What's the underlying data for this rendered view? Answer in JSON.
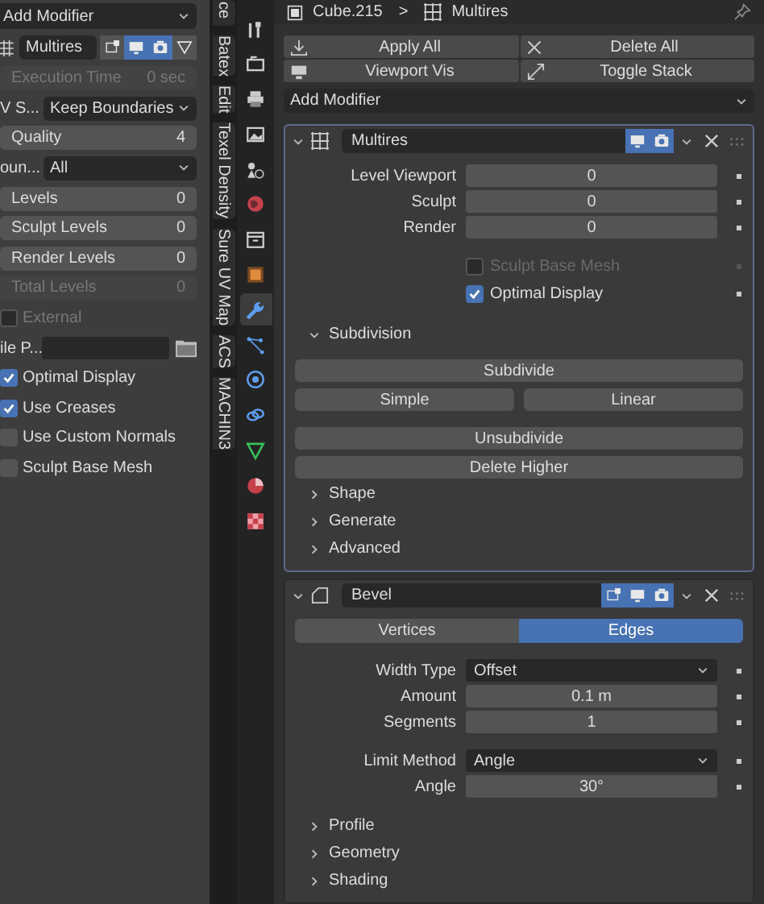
{
  "left_panel": {
    "add_modifier": "Add Modifier",
    "modifier": {
      "name": "Multires",
      "toggles": [
        {
          "kind": "editmode",
          "on": false
        },
        {
          "kind": "viewport",
          "on": true
        },
        {
          "kind": "render",
          "on": true
        },
        {
          "kind": "cage",
          "on": false
        }
      ]
    },
    "rows": [
      {
        "kind": "number",
        "label": "Execution Time",
        "value": "0 sec",
        "disabled": true
      },
      {
        "kind": "dropdown",
        "label": "V S...",
        "value": "Keep Boundaries"
      },
      {
        "kind": "number",
        "label": "Quality",
        "value": "4",
        "disabled": false
      },
      {
        "kind": "dropdown",
        "label": "oun...",
        "value": "All"
      },
      {
        "kind": "number",
        "label": "Levels",
        "value": "0",
        "disabled": false
      },
      {
        "kind": "number",
        "label": "Sculpt Levels",
        "value": "0",
        "disabled": false
      },
      {
        "kind": "number",
        "label": "Render Levels",
        "value": "0",
        "disabled": false
      },
      {
        "kind": "number",
        "label": "Total Levels",
        "value": "0",
        "disabled": true
      },
      {
        "kind": "checkbox",
        "label": "External",
        "checked": false,
        "disabled": true
      },
      {
        "kind": "path",
        "label": "ile P..."
      },
      {
        "kind": "checkbox",
        "label": "Optimal Display",
        "checked": true,
        "disabled": false
      },
      {
        "kind": "checkbox",
        "label": "Use Creases",
        "checked": true,
        "disabled": false
      },
      {
        "kind": "checkbox",
        "label": "Use Custom Normals",
        "checked": false,
        "disabled": false
      },
      {
        "kind": "checkbox",
        "label": "Sculpt Base Mesh",
        "checked": false,
        "disabled": false
      }
    ]
  },
  "sidebar_tabs": [
    {
      "label": "ce"
    },
    {
      "label": "Batex"
    },
    {
      "label": "Edit"
    },
    {
      "label": "Texel Density"
    },
    {
      "label": "Sure UV Map"
    },
    {
      "label": "ACS"
    },
    {
      "label": "MACHIN3"
    }
  ],
  "property_tabs": [
    {
      "kind": "tool",
      "selected": false
    },
    {
      "kind": "render",
      "selected": false
    },
    {
      "kind": "output",
      "selected": false
    },
    {
      "kind": "view_layer",
      "selected": false
    },
    {
      "kind": "scene",
      "selected": false
    },
    {
      "kind": "world",
      "selected": false
    },
    {
      "kind": "collection",
      "selected": false
    },
    {
      "kind": "object",
      "selected": false
    },
    {
      "kind": "modifier",
      "selected": true
    },
    {
      "kind": "particles",
      "selected": false
    },
    {
      "kind": "physics",
      "selected": false
    },
    {
      "kind": "constraints",
      "selected": false
    },
    {
      "kind": "data",
      "selected": false
    },
    {
      "kind": "material",
      "selected": false
    },
    {
      "kind": "texture",
      "selected": false
    }
  ],
  "header": {
    "object": "Cube.215",
    "separator": ">",
    "modifier": "Multires"
  },
  "stack_buttons": [
    {
      "kind": "apply",
      "label": "Apply All"
    },
    {
      "kind": "delete",
      "label": "Delete All"
    },
    {
      "kind": "viewport",
      "label": "Viewport Vis"
    },
    {
      "kind": "toggle",
      "label": "Toggle Stack"
    }
  ],
  "add_modifier": "Add Modifier",
  "modifiers": [
    {
      "kind": "multires",
      "name": "Multires",
      "expanded": true,
      "active": true,
      "toggles": [
        {
          "kind": "viewport",
          "on": true
        },
        {
          "kind": "render",
          "on": true
        }
      ],
      "groups": [
        [
          {
            "kind": "number",
            "label": "Level Viewport",
            "value": "0"
          },
          {
            "kind": "number",
            "label": "Sculpt",
            "value": "0"
          },
          {
            "kind": "number",
            "label": "Render",
            "value": "0"
          }
        ],
        [
          {
            "kind": "checkbox",
            "label": "Sculpt Base Mesh",
            "checked": false,
            "disabled": true
          },
          {
            "kind": "checkbox",
            "label": "Optimal Display",
            "checked": true,
            "disabled": false
          }
        ],
        [
          {
            "kind": "subpanel",
            "label": "Subdivision",
            "expanded": true,
            "groups": [
              [
                {
                  "kind": "buttons",
                  "rows": [
                    [
                      "Subdivide"
                    ],
                    [
                      "Simple",
                      "Linear"
                    ]
                  ]
                }
              ],
              [
                {
                  "kind": "buttons",
                  "rows": [
                    [
                      "Unsubdivide"
                    ],
                    [
                      "Delete Higher"
                    ]
                  ]
                }
              ]
            ]
          },
          {
            "kind": "subpanel",
            "label": "Shape",
            "expanded": false
          },
          {
            "kind": "subpanel",
            "label": "Generate",
            "expanded": false
          },
          {
            "kind": "subpanel",
            "label": "Advanced",
            "expanded": false
          }
        ]
      ]
    },
    {
      "kind": "bevel",
      "name": "Bevel",
      "expanded": true,
      "active": false,
      "toggles": [
        {
          "kind": "editmode",
          "on": true
        },
        {
          "kind": "viewport",
          "on": true
        },
        {
          "kind": "render",
          "on": true
        }
      ],
      "groups": [
        [
          {
            "kind": "tabs",
            "tabs": [
              {
                "label": "Vertices",
                "selected": false
              },
              {
                "label": "Edges",
                "selected": true
              }
            ]
          }
        ],
        [
          {
            "kind": "dropdown",
            "label": "Width Type",
            "value": "Offset"
          },
          {
            "kind": "number",
            "label": "Amount",
            "value": "0.1 m"
          },
          {
            "kind": "number",
            "label": "Segments",
            "value": "1"
          }
        ],
        [
          {
            "kind": "dropdown",
            "label": "Limit Method",
            "value": "Angle"
          },
          {
            "kind": "number",
            "label": "Angle",
            "value": "30°"
          }
        ],
        [
          {
            "kind": "subpanel",
            "label": "Profile",
            "expanded": false
          },
          {
            "kind": "subpanel",
            "label": "Geometry",
            "expanded": false
          },
          {
            "kind": "subpanel",
            "label": "Shading",
            "expanded": false
          }
        ]
      ]
    }
  ]
}
